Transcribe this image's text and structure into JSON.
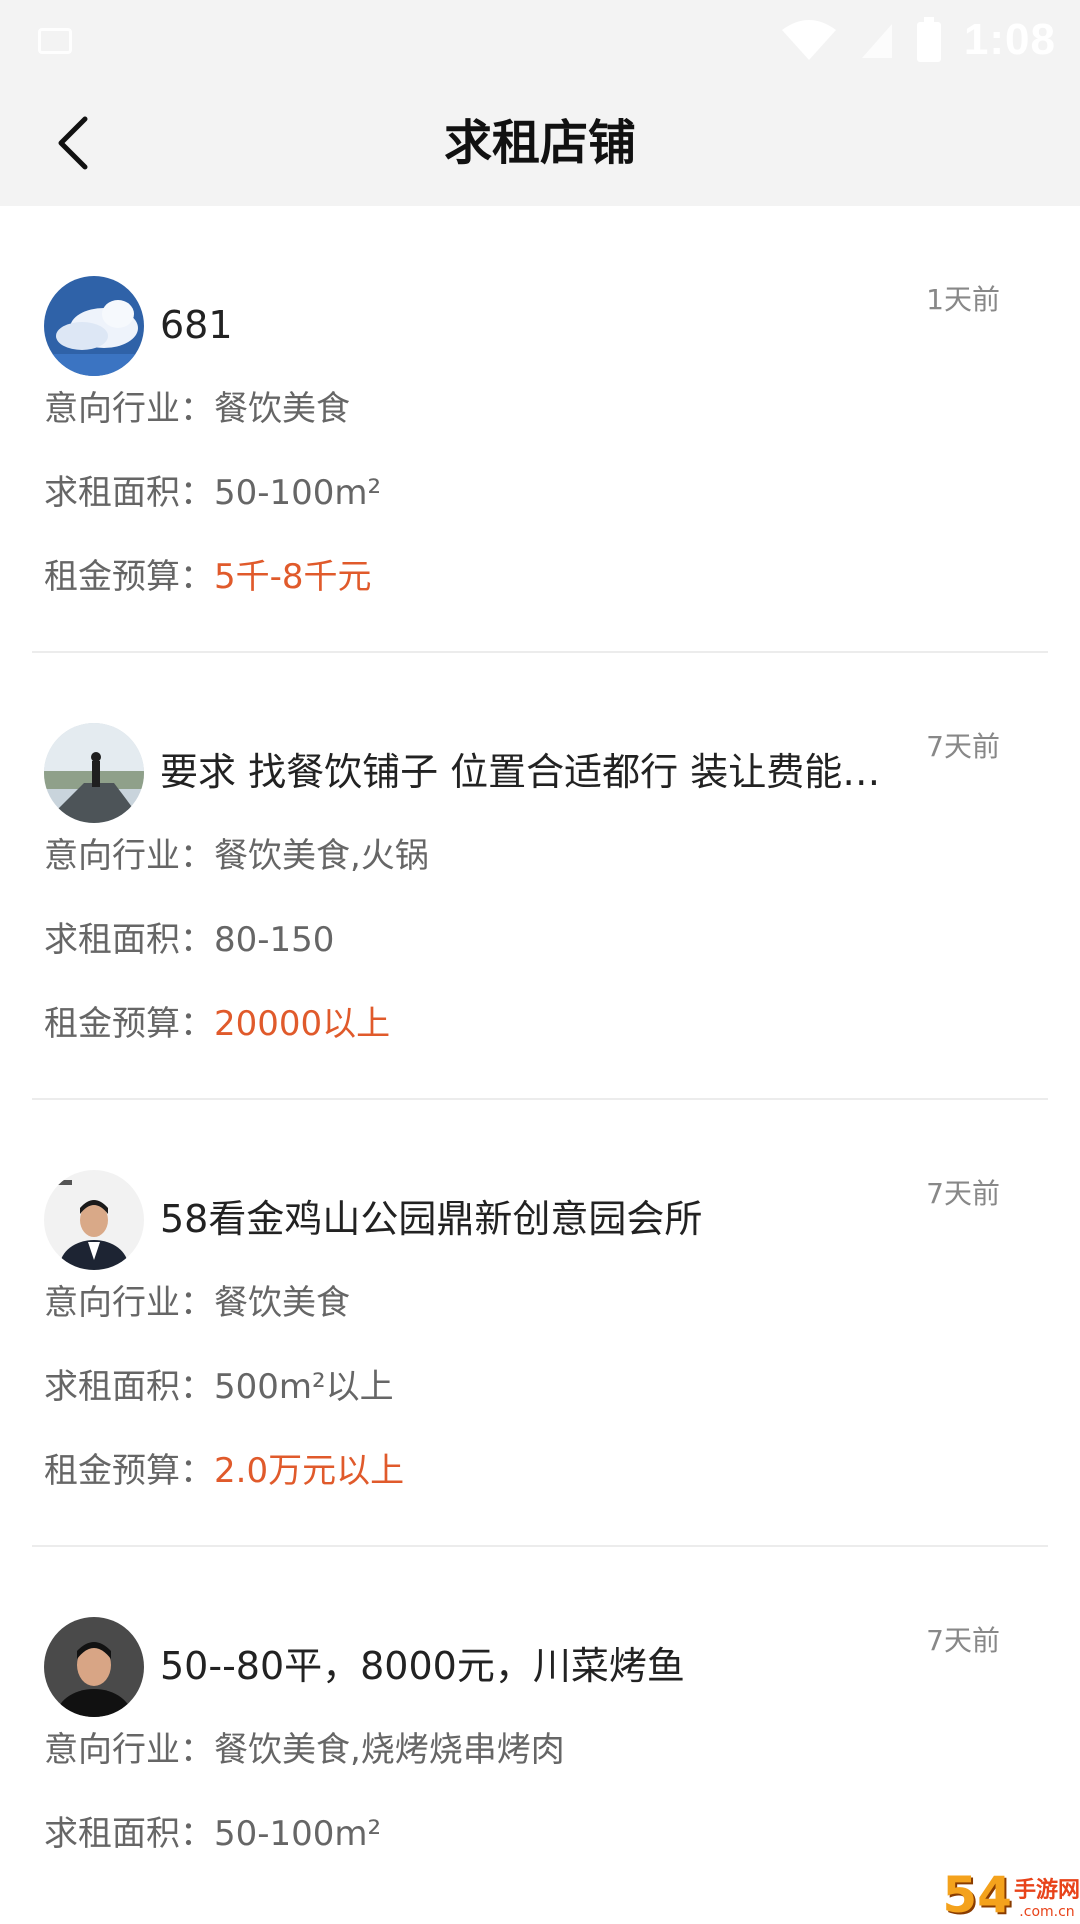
{
  "status_bar": {
    "time": "1:08",
    "icons": [
      "notification-icon",
      "wifi-icon",
      "signal-icon",
      "battery-icon"
    ]
  },
  "header": {
    "title": "求租店铺",
    "back_icon": "chevron-left-icon"
  },
  "labels": {
    "industry": "意向行业：",
    "area": "求租面积：",
    "budget": "租金预算："
  },
  "colors": {
    "price": "#e05a2b",
    "header_bg": "#f3f3f3"
  },
  "listings": [
    {
      "title": "681",
      "time": "1天前",
      "industry": "餐饮美食",
      "area": "50-100m²",
      "budget": "5千-8千元",
      "avatar": "sky-cloud-avatar"
    },
    {
      "title": "要求 找餐饮铺子 位置合适都行 装让费能…",
      "time": "7天前",
      "industry": "餐饮美食,火锅",
      "area": "80-150",
      "budget": "20000以上",
      "avatar": "road-person-avatar"
    },
    {
      "title": "58看金鸡山公园鼎新创意园会所",
      "time": "7天前",
      "industry": "餐饮美食",
      "area": "500m²以上",
      "budget": "2.0万元以上",
      "avatar": "business-man-avatar"
    },
    {
      "title": "50--80平，8000元，川菜烤鱼",
      "time": "7天前",
      "industry": "餐饮美食,烧烤烧串烤肉",
      "area": "50-100m²",
      "budget": "",
      "avatar": "man-portrait-avatar"
    }
  ],
  "watermark": {
    "big": "54",
    "small_cn": "手游网",
    "small_en": ".com.cn"
  }
}
